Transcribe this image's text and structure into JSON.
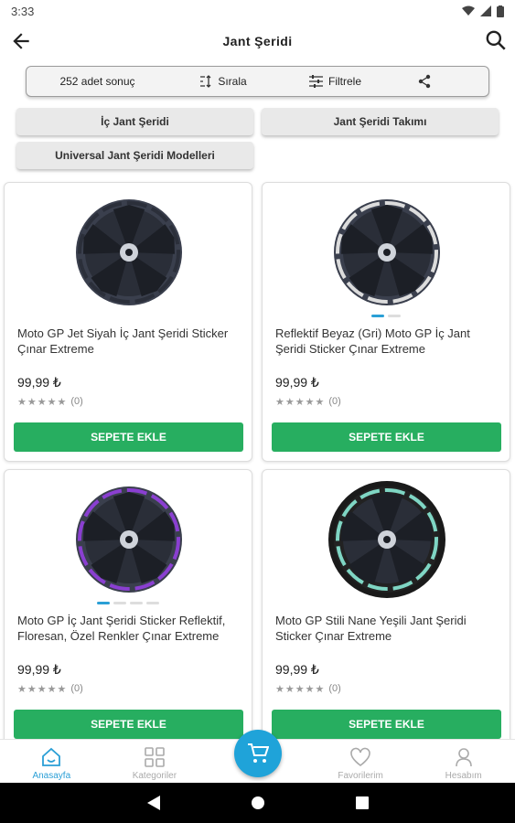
{
  "status": {
    "time": "3:33"
  },
  "header": {
    "title": "Jant Şeridi"
  },
  "toolbar": {
    "result_count": "252 adet sonuç",
    "sort_label": "Sırala",
    "filter_label": "Filtrele"
  },
  "categories": [
    "İç Jant Şeridi",
    "Jant Şeridi Takımı",
    "Universal Jant Şeridi Modelleri"
  ],
  "products": [
    {
      "name": "Moto GP Jet Siyah İç Jant Şeridi Sticker Çınar Extreme",
      "price": "99,99 ₺",
      "stars": "★★★★★",
      "reviews": "(0)",
      "button": "SEPETE EKLE",
      "dots": 0,
      "active_dot": -1,
      "ring_color": "#2b2f3a"
    },
    {
      "name": "Reflektif Beyaz (Gri) Moto GP İç Jant Şeridi Sticker Çınar Extreme",
      "price": "99,99 ₺",
      "stars": "★★★★★",
      "reviews": "(0)",
      "button": "SEPETE EKLE",
      "dots": 2,
      "active_dot": 0,
      "ring_color": "#dcdcdc"
    },
    {
      "name": "Moto GP İç Jant Şeridi Sticker Reflektif, Floresan, Özel Renkler Çınar Extreme",
      "price": "99,99 ₺",
      "stars": "★★★★★",
      "reviews": "(0)",
      "button": "SEPETE EKLE",
      "dots": 4,
      "active_dot": 0,
      "ring_color": "#8a3fd1"
    },
    {
      "name": "Moto GP Stili Nane Yeşili Jant Şeridi Sticker Çınar Extreme",
      "price": "99,99 ₺",
      "stars": "★★★★★",
      "reviews": "(0)",
      "button": "SEPETE EKLE",
      "dots": 0,
      "active_dot": -1,
      "ring_color": "#7fd6c4"
    }
  ],
  "nav": {
    "home": "Anasayfa",
    "categories": "Kategoriler",
    "favorites": "Favorilerim",
    "account": "Hesabım"
  },
  "colors": {
    "accent": "#2a9fd6",
    "add_button": "#27ae60"
  }
}
